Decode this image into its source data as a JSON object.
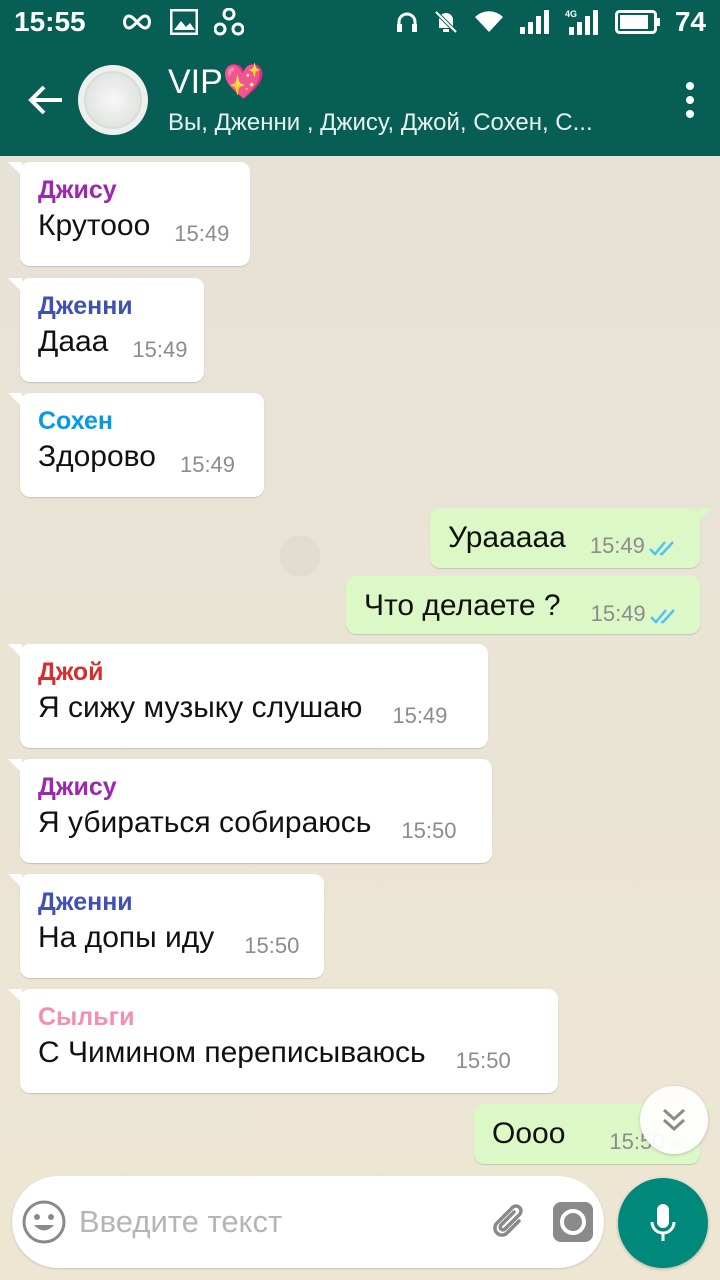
{
  "status_bar": {
    "time": "15:55",
    "battery": "74",
    "network": "4G"
  },
  "header": {
    "title": "VIP",
    "title_emoji": "💖",
    "subtitle": "Вы, Дженни , Джису, Джой, Сохен, С..."
  },
  "messages": [
    {
      "sender": "Джису",
      "sender_color": "#9c27b0",
      "text": "Крутооо",
      "time": "15:49"
    },
    {
      "sender": "Дженни",
      "sender_color": "#3f51b5",
      "text": "Дааа",
      "time": "15:49"
    },
    {
      "sender": "Сохен",
      "sender_color": "#039be5",
      "text": "Здорово",
      "time": "15:49"
    },
    {
      "sender": "",
      "text": "Урааааа",
      "time": "15:49"
    },
    {
      "sender": "",
      "text": "Что делаете ?",
      "time": "15:49"
    },
    {
      "sender": "Джой",
      "sender_color": "#d32f2f",
      "text": "Я сижу музыку слушаю",
      "time": "15:49"
    },
    {
      "sender": "Джису",
      "sender_color": "#9c27b0",
      "text": "Я убираться собираюсь",
      "time": "15:50"
    },
    {
      "sender": "Дженни",
      "sender_color": "#3f51b5",
      "text": "На допы иду",
      "time": "15:50"
    },
    {
      "sender": "Сыльги",
      "sender_color": "#f48fb1",
      "text": "С Чимином переписываюсь",
      "time": "15:50"
    },
    {
      "sender": "",
      "text": "Оооо",
      "time": "15:50"
    }
  ],
  "composer": {
    "placeholder": "Введите текст"
  },
  "colors": {
    "header_bg": "#075e54",
    "outgoing_bubble": "#dcf8c6",
    "incoming_bubble": "#ffffff",
    "tick_read": "#4fc3f7",
    "mic_button": "#00897b"
  }
}
